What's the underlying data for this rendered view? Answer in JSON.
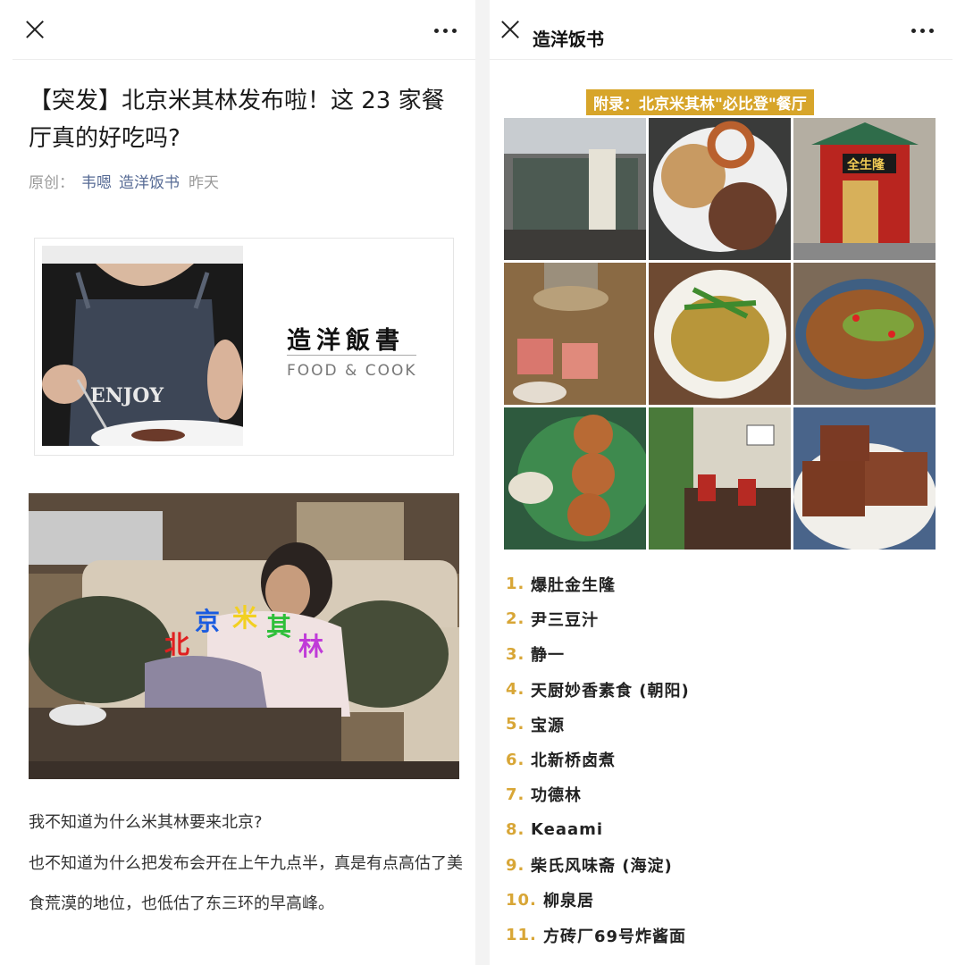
{
  "left": {
    "article": {
      "title": "【突发】北京米其林发布啦！这 23 家餐厅真的好吃吗?",
      "meta_prefix": "原创：",
      "author": "韦嗯",
      "account": "造洋饭书",
      "time": "昨天"
    },
    "banner": {
      "brand_cn": "造洋飯書",
      "brand_en": "FOOD & COOK",
      "apron_text": "ENJOY"
    },
    "scene": {
      "chars": [
        "北",
        "京",
        "米",
        "其",
        "林"
      ]
    },
    "paragraphs": [
      "我不知道为什么米其林要来北京?",
      "也不知道为什么把发布会开在上午九点半，真是有点高估了美食荒漠的地位，也低估了东三环的早高峰。"
    ]
  },
  "right": {
    "header_title": "造洋饭书",
    "appendix": "附录：北京米其林\"必比登\"餐厅",
    "restaurant_sign": "全生隆",
    "restaurants": [
      {
        "num": "1.",
        "name": "爆肚金生隆"
      },
      {
        "num": "2.",
        "name": "尹三豆汁"
      },
      {
        "num": "3.",
        "name": "静一"
      },
      {
        "num": "4.",
        "name": "天厨妙香素食 (朝阳)"
      },
      {
        "num": "5.",
        "name": "宝源"
      },
      {
        "num": "6.",
        "name": "北新桥卤煮"
      },
      {
        "num": "7.",
        "name": "功德林"
      },
      {
        "num": "8.",
        "name": "Keaami"
      },
      {
        "num": "9.",
        "name": "柴氏风味斋 (海淀)"
      },
      {
        "num": "10.",
        "name": "柳泉居"
      },
      {
        "num": "11.",
        "name": "方砖厂69号炸酱面"
      }
    ]
  },
  "colors": {
    "link": "#576b95",
    "appendix_bg": "#d7a52a",
    "list_number": "#d8a636",
    "meta_gray": "#9a9a9a"
  },
  "icons": {
    "close": "close-icon",
    "more": "more-icon"
  }
}
